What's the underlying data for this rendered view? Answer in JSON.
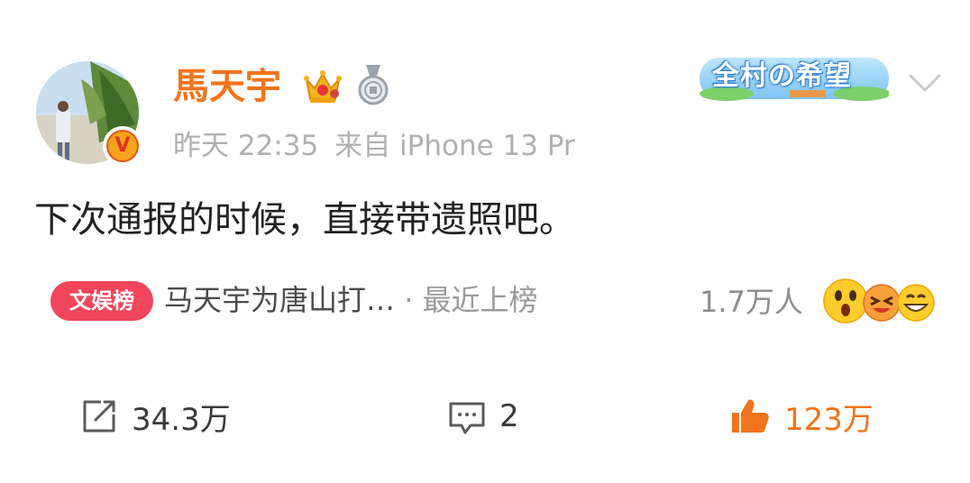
{
  "post": {
    "author": {
      "name": "馬天宇",
      "verified_badge": "V",
      "crown_icon": "crown-icon",
      "medal_icon": "medal-icon"
    },
    "banner_text": "全村の希望",
    "meta": {
      "time": "昨天 22:35",
      "source": "来自 iPhone 13 Pr"
    },
    "content": "下次通报的时候，直接带遗照吧。",
    "trending": {
      "tag": "文娱榜",
      "topic": "马天宇为唐山打…",
      "separator": "·",
      "status": "最近上榜",
      "count": "1.7万人"
    },
    "actions": {
      "repost": "34.3万",
      "comment": "2",
      "like": "123万"
    }
  },
  "colors": {
    "name": "#f2741b",
    "like": "#f2741b",
    "tag_bg": "#f0455a",
    "meta": "#b0b0b0"
  }
}
